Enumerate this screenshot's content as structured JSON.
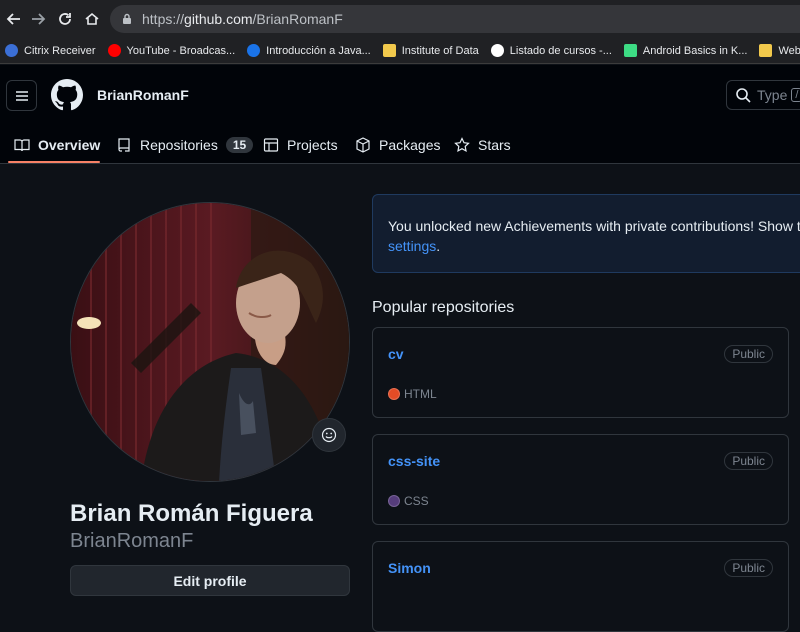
{
  "browser": {
    "url_scheme": "https://",
    "url_host": "github.com",
    "url_path": "/BrianRomanF",
    "bookmarks": [
      {
        "label": "Citrix Receiver",
        "icon": "citrix-icon",
        "color": "#3b6fd6"
      },
      {
        "label": "YouTube - Broadcas...",
        "icon": "youtube-icon",
        "color": "#ff0000"
      },
      {
        "label": "Introducción a Java...",
        "icon": "c-icon",
        "color": "#1a73e8"
      },
      {
        "label": "Institute of Data",
        "icon": "folder-icon",
        "color": "#f2c94c"
      },
      {
        "label": "Listado de cursos -...",
        "icon": "google-icon",
        "color": "#ffffff"
      },
      {
        "label": "Android Basics in K...",
        "icon": "android-icon",
        "color": "#3ddc84"
      },
      {
        "label": "Web",
        "icon": "folder-icon",
        "color": "#f2c94c"
      },
      {
        "label": "",
        "icon": "folder-icon",
        "color": "#f2c94c"
      }
    ]
  },
  "header": {
    "username": "BrianRomanF",
    "search_placeholder": "Type",
    "search_key": "/"
  },
  "tabs": [
    {
      "label": "Overview",
      "icon": "book-icon",
      "active": true
    },
    {
      "label": "Repositories",
      "icon": "repo-icon",
      "count": "15"
    },
    {
      "label": "Projects",
      "icon": "table-icon"
    },
    {
      "label": "Packages",
      "icon": "package-icon"
    },
    {
      "label": "Stars",
      "icon": "star-icon"
    }
  ],
  "profile": {
    "full_name": "Brian Román Figuera",
    "login": "BrianRomanF",
    "edit_label": "Edit profile"
  },
  "flash": {
    "text": "You unlocked new Achievements with private contributions! Show them",
    "link": "settings",
    "suffix": "."
  },
  "popular": {
    "title": "Popular repositories",
    "repos": [
      {
        "name": "cv",
        "visibility": "Public",
        "language": "HTML",
        "lang_color": "#e34c26"
      },
      {
        "name": "css-site",
        "visibility": "Public",
        "language": "CSS",
        "lang_color": "#563d7c"
      },
      {
        "name": "Simon",
        "visibility": "Public",
        "language": "",
        "lang_color": ""
      }
    ]
  },
  "colors": {
    "accent": "#4493f8",
    "tab_underline": "#f78166",
    "background": "#0d1117"
  }
}
